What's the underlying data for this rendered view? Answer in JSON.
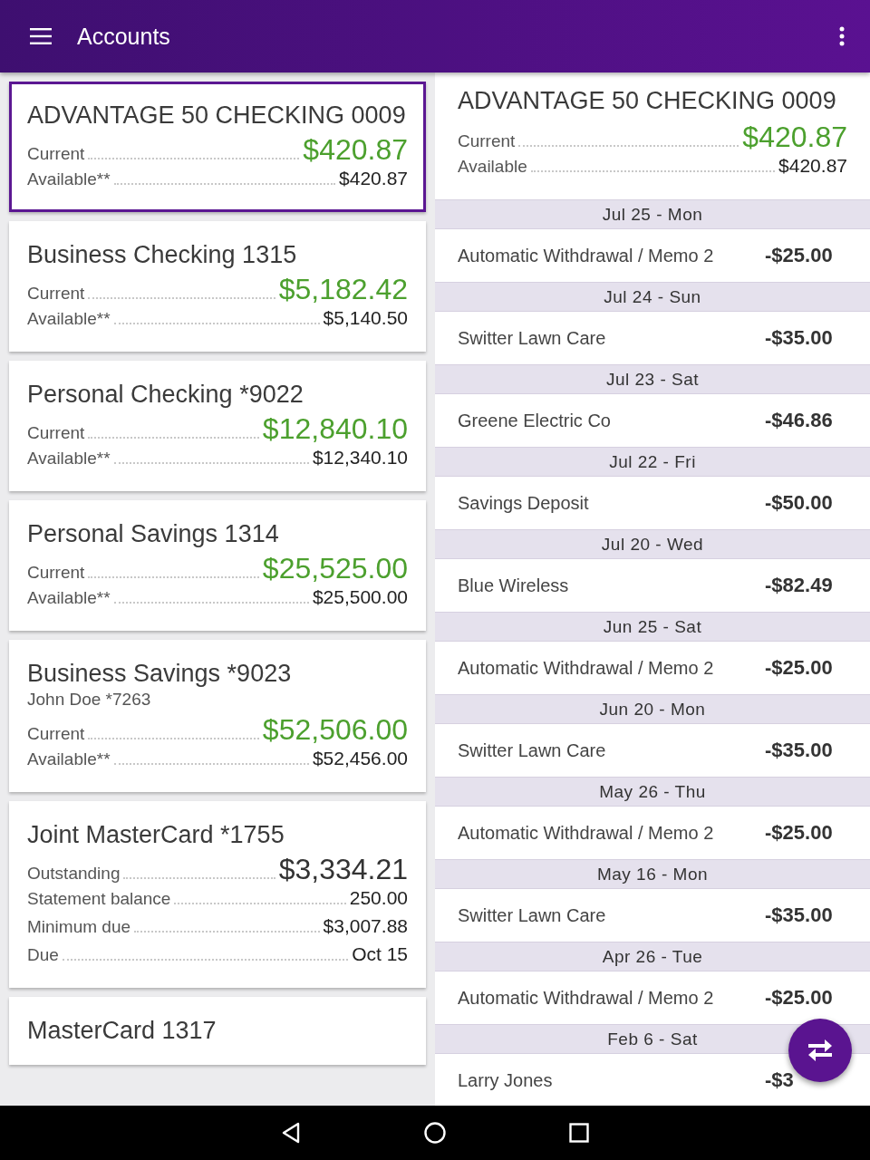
{
  "app_bar": {
    "title": "Accounts"
  },
  "accounts": [
    {
      "name": "ADVANTAGE 50 CHECKING 0009",
      "selected": true,
      "rows": [
        {
          "kind": "current",
          "label": "Current",
          "value": "$420.87"
        },
        {
          "kind": "plain",
          "label": "Available**",
          "value": "$420.87"
        }
      ]
    },
    {
      "name": "Business Checking 1315",
      "selected": false,
      "rows": [
        {
          "kind": "current",
          "label": "Current",
          "value": "$5,182.42"
        },
        {
          "kind": "plain",
          "label": "Available**",
          "value": "$5,140.50"
        }
      ]
    },
    {
      "name": "Personal Checking *9022",
      "selected": false,
      "rows": [
        {
          "kind": "current",
          "label": "Current",
          "value": "$12,840.10"
        },
        {
          "kind": "plain",
          "label": "Available**",
          "value": "$12,340.10"
        }
      ]
    },
    {
      "name": "Personal Savings 1314",
      "selected": false,
      "rows": [
        {
          "kind": "current",
          "label": "Current",
          "value": "$25,525.00"
        },
        {
          "kind": "plain",
          "label": "Available**",
          "value": "$25,500.00"
        }
      ]
    },
    {
      "name": "Business Savings *9023",
      "subtitle": "John Doe *7263",
      "selected": false,
      "rows": [
        {
          "kind": "current",
          "label": "Current",
          "value": "$52,506.00"
        },
        {
          "kind": "plain",
          "label": "Available**",
          "value": "$52,456.00"
        }
      ]
    },
    {
      "name": "Joint MasterCard *1755",
      "selected": false,
      "rows": [
        {
          "kind": "outstanding",
          "label": "Outstanding",
          "value": "$3,334.21"
        },
        {
          "kind": "plain",
          "label": "Statement balance",
          "value": "250.00"
        },
        {
          "kind": "plain",
          "label": "Minimum due",
          "value": "$3,007.88"
        },
        {
          "kind": "plain",
          "label": "Due",
          "value": "Oct 15"
        }
      ]
    },
    {
      "name": "MasterCard 1317",
      "selected": false
    }
  ],
  "detail": {
    "title": "ADVANTAGE 50 CHECKING 0009",
    "rows": [
      {
        "kind": "current",
        "label": "Current",
        "value": "$420.87"
      },
      {
        "kind": "plain",
        "label": "Available",
        "value": "$420.87"
      }
    ],
    "transactions": [
      {
        "date": "Jul 25 - Mon",
        "description": "Automatic Withdrawal / Memo 2",
        "amount": "-$25.00"
      },
      {
        "date": "Jul 24 - Sun",
        "description": "Switter Lawn Care",
        "amount": "-$35.00"
      },
      {
        "date": "Jul 23 - Sat",
        "description": "Greene Electric Co",
        "amount": "-$46.86"
      },
      {
        "date": "Jul 22 - Fri",
        "description": "Savings Deposit",
        "amount": "-$50.00"
      },
      {
        "date": "Jul 20 - Wed",
        "description": "Blue Wireless",
        "amount": "-$82.49"
      },
      {
        "date": "Jun 25 - Sat",
        "description": "Automatic Withdrawal / Memo 2",
        "amount": "-$25.00"
      },
      {
        "date": "Jun 20 - Mon",
        "description": "Switter Lawn Care",
        "amount": "-$35.00"
      },
      {
        "date": "May 26 - Thu",
        "description": "Automatic Withdrawal / Memo 2",
        "amount": "-$25.00"
      },
      {
        "date": "May 16 - Mon",
        "description": "Switter Lawn Care",
        "amount": "-$35.00"
      },
      {
        "date": "Apr 26 - Tue",
        "description": "Automatic Withdrawal / Memo 2",
        "amount": "-$25.00"
      },
      {
        "date": "Feb 6 - Sat",
        "description": "Larry Jones",
        "amount": "-$3"
      }
    ]
  }
}
